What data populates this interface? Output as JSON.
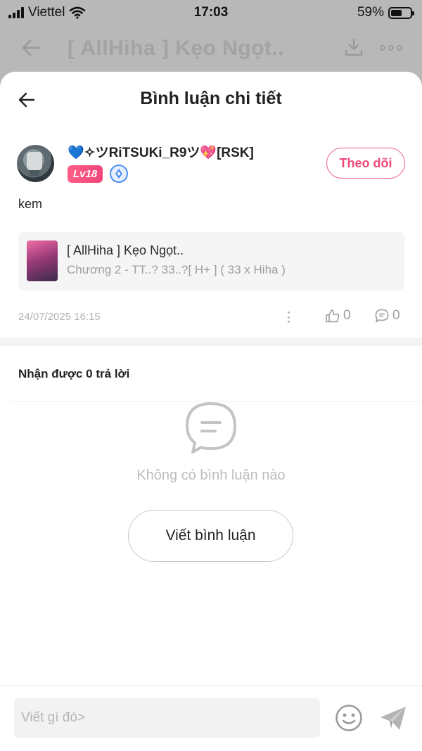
{
  "status_bar": {
    "carrier": "Viettel",
    "time": "17:03",
    "battery": "59%",
    "battery_level": 0.59
  },
  "background_app": {
    "title": "[ AllHiha ] Kẹo Ngọt.."
  },
  "sheet": {
    "title": "Bình luận chi tiết",
    "comment": {
      "user_name": "💙✧ツRiTSUKi_R9ツ💖[RSK]",
      "level": "Lv18",
      "follow_label": "Theo dõi",
      "text": "kem",
      "story": {
        "title": "[ AllHiha ] Kẹo Ngọt..",
        "chapter": "Chương 2 - TT..? 33..?[ H+ ] ( 33 x Hiha )"
      },
      "date": "24/07/2025 16:15",
      "likes": "0",
      "replies": "0"
    },
    "replies_heading": "Nhận được 0 trả lời",
    "empty_text": "Không có bình luận nào",
    "write_button": "Viết bình luận",
    "input_placeholder": "Viết gì đó>"
  },
  "colors": {
    "accent": "#ef4a78",
    "muted": "#bdbdbd"
  },
  "icons": [
    "signal-icon",
    "wifi-icon",
    "battery-icon",
    "back-arrow-icon",
    "download-icon",
    "more-icon",
    "medal-icon",
    "kebab-icon",
    "thumbs-up-icon",
    "comment-icon",
    "empty-chat-icon",
    "emoji-icon",
    "send-icon"
  ]
}
